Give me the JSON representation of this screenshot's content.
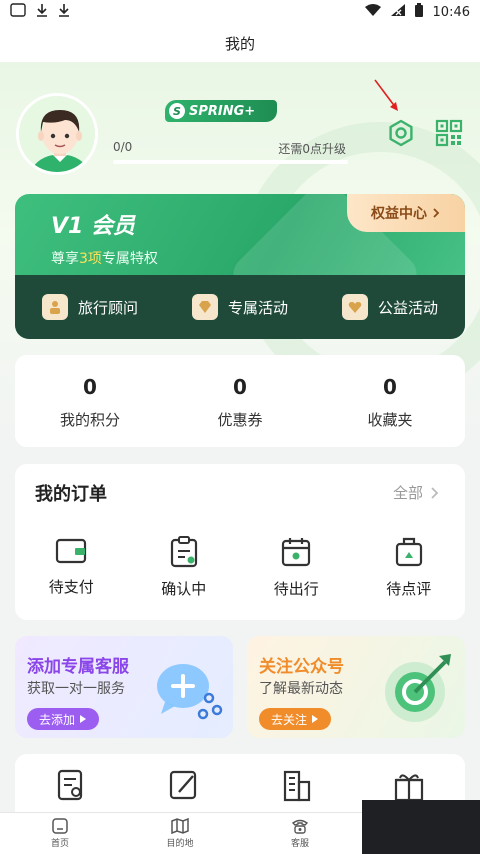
{
  "status_bar": {
    "time": "10:46"
  },
  "title": "我的",
  "profile": {
    "brand_badge": "SPRING+",
    "progress_text": "0/0",
    "upgrade_text": "还需0点升级",
    "progress_fraction": 0.0
  },
  "vip": {
    "title": "V1 会员",
    "subtitle_prefix": "尊享",
    "subtitle_highlight": "3项",
    "subtitle_suffix": "专属特权",
    "benefit_button": "权益中心",
    "perks": [
      "旅行顾问",
      "专属活动",
      "公益活动"
    ]
  },
  "stats": [
    {
      "value": "0",
      "label": "我的积分"
    },
    {
      "value": "0",
      "label": "优惠券"
    },
    {
      "value": "0",
      "label": "收藏夹"
    }
  ],
  "orders": {
    "title": "我的订单",
    "all_label": "全部",
    "items": [
      "待支付",
      "确认中",
      "待出行",
      "待点评"
    ]
  },
  "promos": {
    "left": {
      "title": "添加专属客服",
      "subtitle": "获取一对一服务",
      "button": "去添加"
    },
    "right": {
      "title": "关注公众号",
      "subtitle": "了解最新动态",
      "button": "去关注"
    }
  },
  "tabbar": [
    "首页",
    "目的地",
    "客服"
  ],
  "colors": {
    "brand_green": "#2aa86a",
    "vip_dark": "#1f4a3a",
    "promo_purple": "#9b5ef0",
    "promo_orange": "#f08c2a",
    "promo_title_purple": "#8a46e8",
    "promo_title_orange": "#f08c2a"
  }
}
